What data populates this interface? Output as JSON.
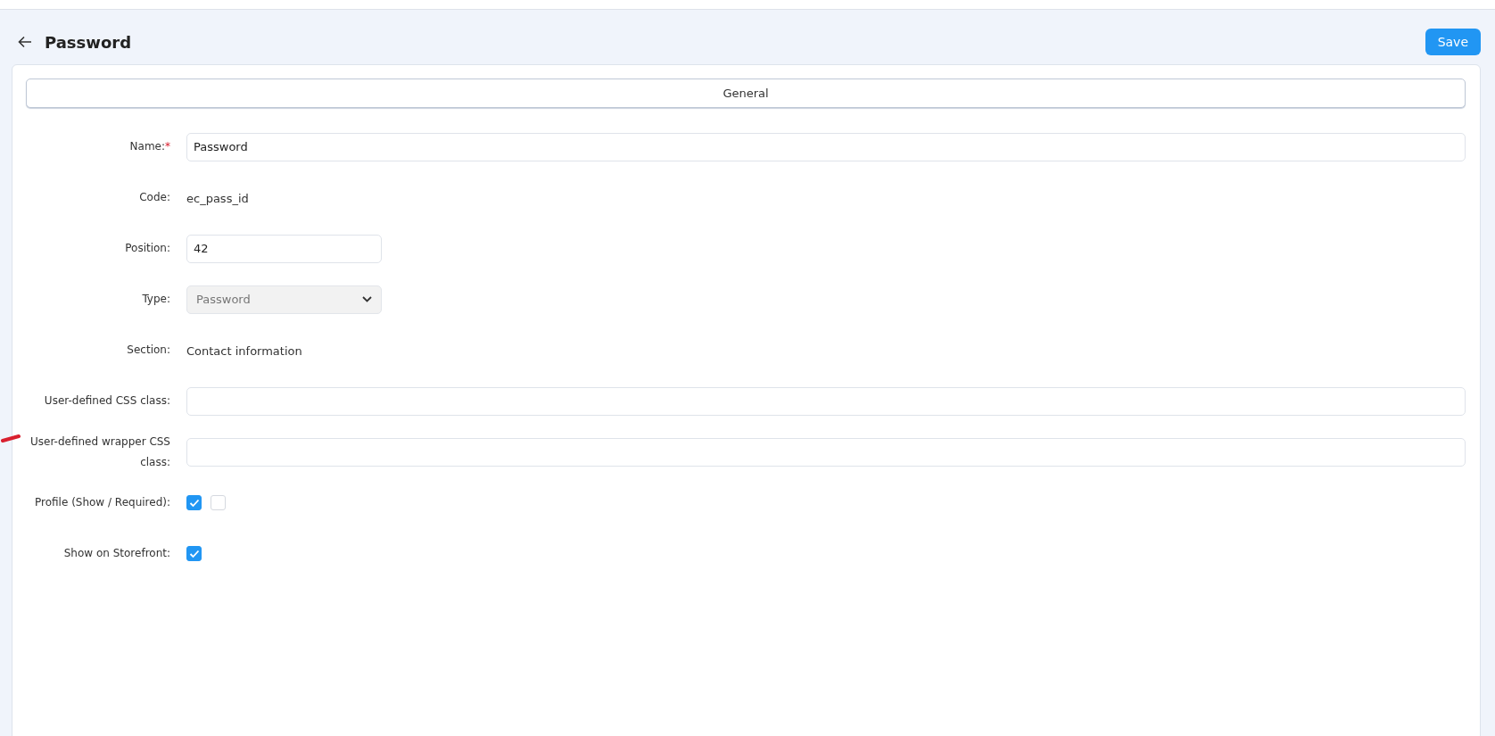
{
  "header": {
    "title": "Password",
    "save_button": "Save"
  },
  "tabs": [
    {
      "label": "General",
      "selected": true
    }
  ],
  "fields": [
    {
      "kind": "input",
      "label": "Name:",
      "required_mark": "*",
      "value": "Password",
      "wide": true
    },
    {
      "kind": "text",
      "label": "Code:",
      "value": "ec_pass_id"
    },
    {
      "kind": "input",
      "label": "Position:",
      "value": "42",
      "wide": false
    },
    {
      "kind": "select",
      "label": "Type:",
      "value": "Password",
      "disabled": true
    },
    {
      "kind": "text",
      "label": "Section:",
      "value": "Contact information"
    },
    {
      "kind": "input",
      "label": "User-defined CSS class:",
      "wide": true
    },
    {
      "kind": "input",
      "label": "User-defined wrapper CSS class:",
      "wide": true
    },
    {
      "kind": "checkboxes",
      "label": "Profile (Show / Required):",
      "boxes": [
        {
          "checked": true
        },
        {
          "checked": false
        }
      ]
    },
    {
      "kind": "checkboxes",
      "label": "Show on Storefront:",
      "boxes": [
        {
          "checked": true
        }
      ]
    }
  ]
}
